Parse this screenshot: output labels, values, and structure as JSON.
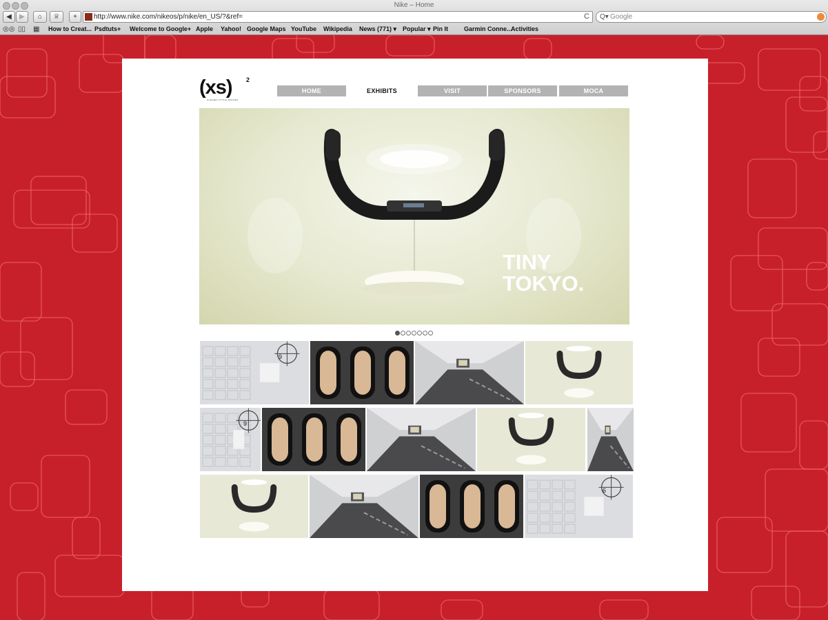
{
  "window": {
    "title": "Nike – Home"
  },
  "toolbar": {
    "back_label": "◀",
    "forward_label": "▶",
    "home_label": "⌂",
    "bookmark_label": "♕",
    "new_tab_label": "+",
    "url": "http://www.nike.com/nikeos/p/nike/en_US/?&ref=",
    "reload_label": "C",
    "search_placeholder": "Google",
    "search_glass": "Q▾"
  },
  "bookmarks": [
    {
      "label": "How to Creat..."
    },
    {
      "label": "Psdtuts+"
    },
    {
      "label": "Welcome to Google+"
    },
    {
      "label": "Apple"
    },
    {
      "label": "Yahoo!"
    },
    {
      "label": "Google Maps"
    },
    {
      "label": "YouTube"
    },
    {
      "label": "Wikipedia"
    },
    {
      "label": "News (771) ▾"
    },
    {
      "label": "Popular ▾"
    },
    {
      "label": "Pin It"
    },
    {
      "label": "Garmin Conne..."
    },
    {
      "label": "Activities"
    }
  ],
  "site": {
    "logo_text": "(xs)",
    "logo_sup": "2",
    "logo_tagline": "CLEVER LITTLE SPACES",
    "nav": [
      {
        "label": "HOME",
        "active": false
      },
      {
        "label": "EXHIBITS",
        "active": true
      },
      {
        "label": "VISIT",
        "active": false
      },
      {
        "label": "SPONSORS",
        "active": false
      },
      {
        "label": "MOCA",
        "active": false
      }
    ],
    "hero_line1": "TINY",
    "hero_line2": "TOKYO.",
    "slider": {
      "count": 7,
      "active": 0
    },
    "thumbs": [
      {
        "kind": "lockers",
        "label": "9"
      },
      {
        "kind": "capsules"
      },
      {
        "kind": "hallway"
      },
      {
        "kind": "headrest"
      },
      {
        "kind": "lockers",
        "label": "9"
      },
      {
        "kind": "capsules"
      },
      {
        "kind": "hallway"
      },
      {
        "kind": "headrest"
      },
      {
        "kind": "hallway"
      },
      {
        "kind": "headrest"
      },
      {
        "kind": "hallway"
      },
      {
        "kind": "capsules"
      },
      {
        "kind": "lockers",
        "label": "6"
      }
    ]
  },
  "colors": {
    "background": "#c8202a",
    "nav_inactive": "#b3b3b4",
    "outline": "#f0666c"
  }
}
